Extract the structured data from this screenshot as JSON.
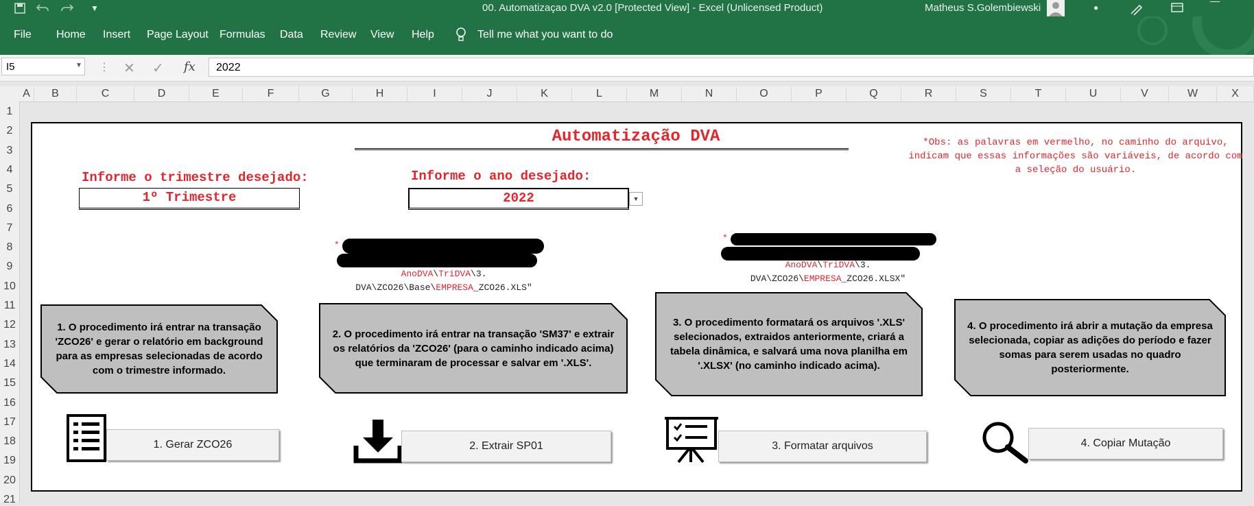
{
  "window": {
    "title": "00. Automatizaçao DVA v2.0  [Protected View]  -  Excel (Unlicensed Product)",
    "user": "Matheus S.Golembiewski"
  },
  "menu": [
    "File",
    "Home",
    "Insert",
    "Page Layout",
    "Formulas",
    "Data",
    "Review",
    "View",
    "Help",
    "Tell me what you want to do"
  ],
  "formula_bar": {
    "name_box": "I5",
    "value": "2022",
    "fx": "fx"
  },
  "columns": [
    "A",
    "B",
    "C",
    "D",
    "E",
    "F",
    "G",
    "H",
    "I",
    "J",
    "K",
    "L",
    "M",
    "N",
    "O",
    "P",
    "Q",
    "R",
    "S",
    "T",
    "U",
    "V",
    "W",
    "X"
  ],
  "rows": [
    "1",
    "2",
    "3",
    "4",
    "5",
    "6",
    "7",
    "8",
    "9",
    "10",
    "11",
    "12",
    "13",
    "14",
    "15",
    "16",
    "17",
    "18",
    "19",
    "20",
    "21"
  ],
  "sheet": {
    "title": "Automatização DVA",
    "note": "*Obs: as palavras em vermelho, no caminho do arquivo, indicam que essas informações são variáveis, de acordo com a seleção do usuário.",
    "quarter_label": "Informe o trimestre desejado:",
    "quarter_value": "1º Trimestre",
    "year_label": "Informe o ano desejado:",
    "year_value": "2022",
    "path1": {
      "star": "*",
      "var1": "AnoDVA",
      "sep1": "\\",
      "var2": "TriDVA",
      "tail1": "\\3.",
      "line2a": "DVA\\ZCO26\\Base\\",
      "var3": "EMPRESA",
      "line2b": "_ZCO26.XLS\""
    },
    "path2": {
      "star": "*",
      "var1": "AnoDVA",
      "sep1": "\\",
      "var2": "TriDVA",
      "tail1": "\\3.",
      "line2a": "DVA\\ZCO26\\",
      "var3": "EMPRESA",
      "line2b": "_ZCO26.XLSX\""
    },
    "steps": [
      "1. O procedimento irá entrar na transação 'ZCO26' e gerar o relatório em background para as empresas selecionadas de acordo com o trimestre informado.",
      "2. O procedimento irá entrar na transação 'SM37' e extrair os relatórios da 'ZCO26' (para o caminho indicado acima) que terminaram de processar e salvar em '.XLS'.",
      "3. O procedimento formatará os arquivos '.XLS' selecionados, extraidos anteriormente, criará a tabela dinâmica, e salvará uma nova planilha em '.XLSX' (no caminho indicado acima).",
      "4. O procedimento irá abrir a mutação da empresa selecionada, copiar as adições do período e fazer somas para serem usadas no quadro posteriormente."
    ],
    "buttons": [
      "1. Gerar ZCO26",
      "2. Extrair SP01",
      "3. Formatar arquivos",
      "4. Copiar Mutação"
    ]
  },
  "colors": {
    "excel_green": "#217346",
    "accent_red": "#e3262b",
    "card_gray": "#bfbfbf"
  }
}
